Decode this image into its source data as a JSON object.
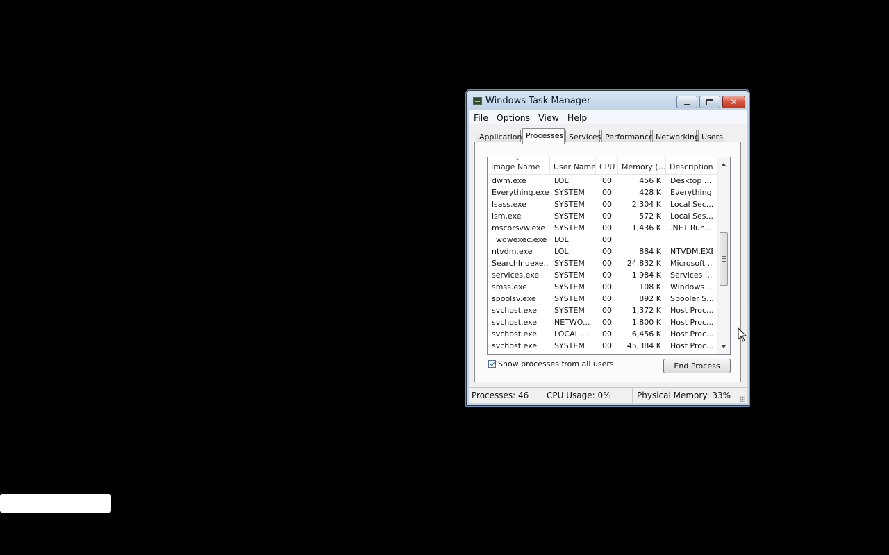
{
  "window": {
    "title": "Windows Task Manager",
    "close_glyph": "✕"
  },
  "menu": [
    "File",
    "Options",
    "View",
    "Help"
  ],
  "tabs": [
    "Applications",
    "Processes",
    "Services",
    "Performance",
    "Networking",
    "Users"
  ],
  "active_tab": "Processes",
  "columns": {
    "image_name": "Image Name",
    "user_name": "User Name",
    "cpu": "CPU",
    "memory": "Memory (...",
    "description": "Description"
  },
  "processes": [
    {
      "name": "dwm.exe",
      "user": "LOL",
      "cpu": "00",
      "memory": "456 K",
      "description": "Desktop ..."
    },
    {
      "name": "Everything.exe",
      "user": "SYSTEM",
      "cpu": "00",
      "memory": "428 K",
      "description": "Everything"
    },
    {
      "name": "lsass.exe",
      "user": "SYSTEM",
      "cpu": "00",
      "memory": "2,304 K",
      "description": "Local Sec..."
    },
    {
      "name": "lsm.exe",
      "user": "SYSTEM",
      "cpu": "00",
      "memory": "572 K",
      "description": "Local Ses..."
    },
    {
      "name": "mscorsvw.exe",
      "user": "SYSTEM",
      "cpu": "00",
      "memory": "1,436 K",
      "description": ".NET Run..."
    },
    {
      "name": "wowexec.exe",
      "user": "LOL",
      "cpu": "00",
      "memory": "",
      "description": ""
    },
    {
      "name": "ntvdm.exe",
      "user": "LOL",
      "cpu": "00",
      "memory": "884 K",
      "description": "NTVDM.EXE"
    },
    {
      "name": "SearchIndexe...",
      "user": "SYSTEM",
      "cpu": "00",
      "memory": "24,832 K",
      "description": "Microsoft ..."
    },
    {
      "name": "services.exe",
      "user": "SYSTEM",
      "cpu": "00",
      "memory": "1,984 K",
      "description": "Services ..."
    },
    {
      "name": "smss.exe",
      "user": "SYSTEM",
      "cpu": "00",
      "memory": "108 K",
      "description": "Windows ..."
    },
    {
      "name": "spoolsv.exe",
      "user": "SYSTEM",
      "cpu": "00",
      "memory": "892 K",
      "description": "Spooler S..."
    },
    {
      "name": "svchost.exe",
      "user": "SYSTEM",
      "cpu": "00",
      "memory": "1,372 K",
      "description": "Host Proc..."
    },
    {
      "name": "svchost.exe",
      "user": "NETWO...",
      "cpu": "00",
      "memory": "1,800 K",
      "description": "Host Proc..."
    },
    {
      "name": "svchost.exe",
      "user": "LOCAL ...",
      "cpu": "00",
      "memory": "6,456 K",
      "description": "Host Proc..."
    },
    {
      "name": "svchost.exe",
      "user": "SYSTEM",
      "cpu": "00",
      "memory": "45,384 K",
      "description": "Host Proc..."
    }
  ],
  "show_all_users": {
    "label": "Show processes from all users",
    "checked": true
  },
  "end_process_label": "End Process",
  "status": {
    "processes": "Processes: 46",
    "cpu": "CPU Usage: 0%",
    "memory": "Physical Memory: 33%"
  }
}
